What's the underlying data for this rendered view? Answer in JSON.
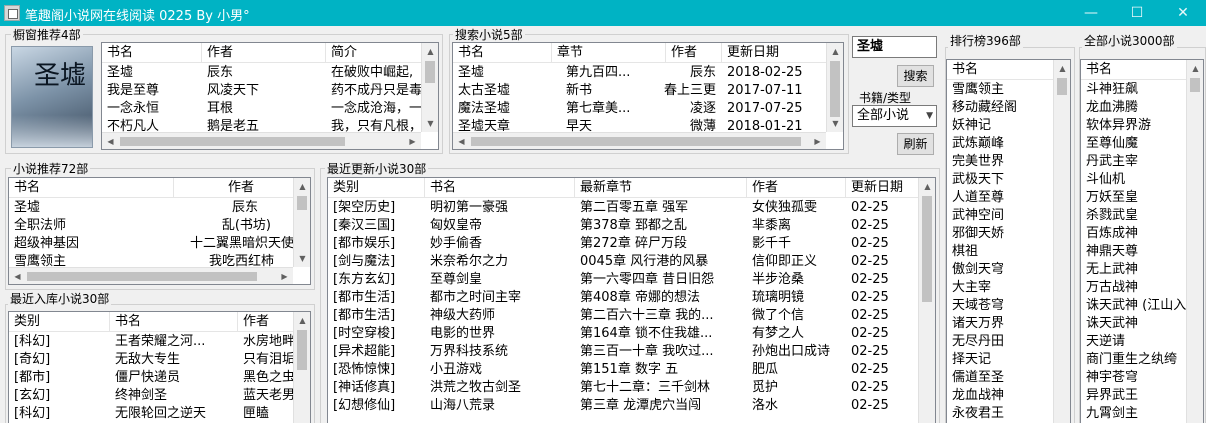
{
  "window": {
    "title": "笔趣阁小说网在线阅读 0225    By 小男°",
    "minimize_glyph": "—",
    "maximize_glyph": "☐",
    "close_glyph": "✕"
  },
  "icons": {
    "app": "app-icon",
    "scroll_up": "▲",
    "scroll_down": "▼",
    "scroll_left": "◀",
    "scroll_right": "▶",
    "dropdown": "▼"
  },
  "featured": {
    "label": "橱窗推荐4部",
    "cover_text": "圣墟",
    "columns": [
      "书名",
      "作者",
      "简介"
    ],
    "rows": [
      [
        "圣墟",
        "辰东",
        "在破败中崛起,"
      ],
      [
        "我是至尊",
        "风凌天下",
        "药不成丹只是毒"
      ],
      [
        "一念永恒",
        "耳根",
        "一念成沧海，一"
      ],
      [
        "不朽凡人",
        "鹅是老五",
        "我，只有凡根，"
      ]
    ]
  },
  "search": {
    "label": "搜索小说5部",
    "columns": [
      "书名",
      "章节",
      "作者",
      "更新日期"
    ],
    "rows": [
      [
        "圣墟",
        "第九百四...",
        "辰东",
        "2018-02-25"
      ],
      [
        "太古圣墟",
        "新书",
        "春上三更",
        "2017-07-11"
      ],
      [
        "魔法圣墟",
        "第七章美...",
        "凌逐",
        "2017-07-25"
      ],
      [
        "圣墟天章",
        "早天",
        "微薄",
        "2018-01-21"
      ]
    ],
    "input_value": "圣墟",
    "search_button": "搜索",
    "category_label": "书籍/类型",
    "category_value": "全部小说",
    "refresh_button": "刷新"
  },
  "recommend": {
    "label": "小说推荐72部",
    "columns": [
      "书名",
      "作者"
    ],
    "rows": [
      [
        "圣墟",
        "辰东"
      ],
      [
        "全职法师",
        "乱(书坊)"
      ],
      [
        "超级神基因",
        "十二翼黑暗炽天使"
      ],
      [
        "雪鹰领主",
        "我吃西红柿"
      ]
    ]
  },
  "recent_added": {
    "label": "最近入库小说30部",
    "columns": [
      "类别",
      "书名",
      "作者"
    ],
    "rows": [
      [
        "[科幻]",
        "王者荣耀之河...",
        "水房地畔"
      ],
      [
        "[奇幻]",
        "无敌大专生",
        "只有泪垢"
      ],
      [
        "[都市]",
        "僵尸快递员",
        "黑色之虫"
      ],
      [
        "[玄幻]",
        "终神剑圣",
        "蓝天老男"
      ],
      [
        "[科幻]",
        "无限轮回之逆天",
        "匣瞌"
      ]
    ]
  },
  "recent_updated": {
    "label": "最近更新小说30部",
    "columns": [
      "类别",
      "书名",
      "最新章节",
      "作者",
      "更新日期"
    ],
    "rows": [
      [
        "[架空历史]",
        "明初第一豪强",
        "第二百零五章 强军",
        "女侠独孤雯",
        "02-25"
      ],
      [
        "[秦汉三国]",
        "匈奴皇帝",
        "第378章 郅都之乱",
        "芈黍离",
        "02-25"
      ],
      [
        "[都市娱乐]",
        "妙手偷香",
        "第272章  碎尸万段",
        "影千千",
        "02-25"
      ],
      [
        "[剑与魔法]",
        "米奈希尔之力",
        "0045章 风行港的风暴",
        "信仰即正义",
        "02-25"
      ],
      [
        "[东方玄幻]",
        "至尊剑皇",
        "第一六零四章 昔日旧怨",
        "半步沧桑",
        "02-25"
      ],
      [
        "[都市生活]",
        "都市之时间主宰",
        "第408章 帝娜的想法",
        "琉璃明镜",
        "02-25"
      ],
      [
        "[都市生活]",
        "神级大药师",
        "第二百六十三章 我的...",
        "微了个信",
        "02-25"
      ],
      [
        "[时空穿梭]",
        "电影的世界",
        "第164章 锁不住我雄...",
        "有梦之人",
        "02-25"
      ],
      [
        "[异术超能]",
        "万界科技系统",
        "第三百一十章 我吹过...",
        "孙炮出口成诗",
        "02-25"
      ],
      [
        "[恐怖惊悚]",
        "小丑游戏",
        "第151章 数字 五",
        "肥瓜",
        "02-25"
      ],
      [
        "[神话修真]",
        "洪荒之牧古剑圣",
        "第七十二章：三千剑林",
        "觅护",
        "02-25"
      ],
      [
        "[幻想修仙]",
        "山海八荒录",
        "第三章 龙潭虎穴当闯",
        "洛水",
        "02-25"
      ]
    ]
  },
  "ranking": {
    "label": "排行榜396部",
    "column": "书名",
    "items": [
      "雪鹰领主",
      "移动藏经阁",
      "妖神记",
      "武炼巅峰",
      "完美世界",
      "武极天下",
      "人道至尊",
      "武神空间",
      "邪御天娇",
      "棋祖",
      "傲剑天穹",
      "大主宰",
      "天域苍穹",
      "诸天万界",
      "无尽丹田",
      "择天记",
      "儒道至圣",
      "龙血战神",
      "永夜君王"
    ]
  },
  "all_novels": {
    "label": "全部小说3000部",
    "column": "书名",
    "items": [
      "斗神狂飙",
      "龙血沸腾",
      "软体异界游",
      "至尊仙魔",
      "丹武主宰",
      "斗仙机",
      "万妖至皇",
      "杀戮武皇",
      "百炼成神",
      "神鼎天尊",
      "无上武神",
      "万古战神",
      "诛天武神 (江山入",
      "诛天武神",
      "天逆请",
      "商门重生之纨绔",
      "神宇苍穹",
      "异界武王",
      "九霄剑主"
    ]
  }
}
